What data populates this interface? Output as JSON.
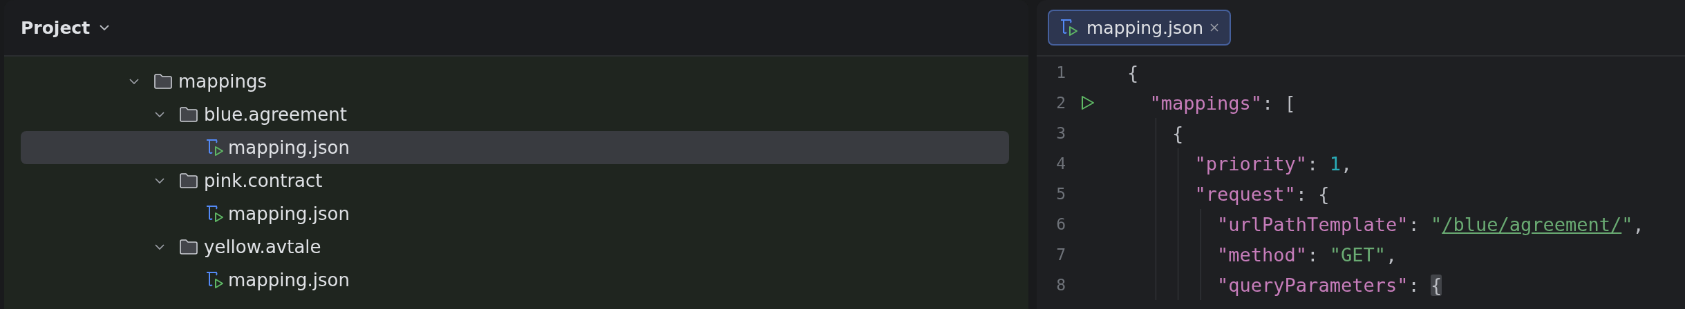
{
  "project_panel": {
    "title": "Project",
    "tree": [
      {
        "label": "mappings",
        "kind": "folder",
        "expanded": true,
        "selected": false,
        "children": [
          {
            "label": "blue.agreement",
            "kind": "folder",
            "expanded": true,
            "selected": false,
            "children": [
              {
                "label": "mapping.json",
                "kind": "file",
                "selected": true
              }
            ]
          },
          {
            "label": "pink.contract",
            "kind": "folder",
            "expanded": true,
            "selected": false,
            "children": [
              {
                "label": "mapping.json",
                "kind": "file",
                "selected": false
              }
            ]
          },
          {
            "label": "yellow.avtale",
            "kind": "folder",
            "expanded": true,
            "selected": false,
            "children": [
              {
                "label": "mapping.json",
                "kind": "file",
                "selected": false
              }
            ]
          }
        ]
      }
    ]
  },
  "editor": {
    "tabs": [
      {
        "label": "mapping.json",
        "selected": true
      }
    ],
    "lines": [
      {
        "number": "1",
        "tokens": [
          {
            "kind": "punct",
            "text": "{"
          }
        ],
        "children": [
          {
            "number": "2",
            "run": true,
            "tokens": [
              {
                "kind": "key",
                "text": "\"mappings\""
              },
              {
                "kind": "punct",
                "text": ": ["
              }
            ],
            "children": [
              {
                "number": "3",
                "tokens": [
                  {
                    "kind": "punct",
                    "text": "{"
                  }
                ],
                "children": [
                  {
                    "number": "4",
                    "tokens": [
                      {
                        "kind": "key",
                        "text": "\"priority\""
                      },
                      {
                        "kind": "punct",
                        "text": ": "
                      },
                      {
                        "kind": "number",
                        "text": "1"
                      },
                      {
                        "kind": "punct",
                        "text": ","
                      }
                    ]
                  },
                  {
                    "number": "5",
                    "tokens": [
                      {
                        "kind": "key",
                        "text": "\"request\""
                      },
                      {
                        "kind": "punct",
                        "text": ": {"
                      }
                    ],
                    "children": [
                      {
                        "number": "6",
                        "tokens": [
                          {
                            "kind": "key",
                            "text": "\"urlPathTemplate\""
                          },
                          {
                            "kind": "punct",
                            "text": ": "
                          },
                          {
                            "kind": "string",
                            "text": "\""
                          },
                          {
                            "kind": "link",
                            "text": "/blue/agreement/"
                          },
                          {
                            "kind": "string",
                            "text": "\""
                          },
                          {
                            "kind": "punct",
                            "text": ","
                          }
                        ]
                      },
                      {
                        "number": "7",
                        "tokens": [
                          {
                            "kind": "key",
                            "text": "\"method\""
                          },
                          {
                            "kind": "punct",
                            "text": ": "
                          },
                          {
                            "kind": "string",
                            "text": "\"GET\""
                          },
                          {
                            "kind": "punct",
                            "text": ","
                          }
                        ]
                      },
                      {
                        "number": "8",
                        "tokens": [
                          {
                            "kind": "key",
                            "text": "\"queryParameters\""
                          },
                          {
                            "kind": "punct",
                            "text": ": "
                          },
                          {
                            "kind": "brace-match",
                            "text": "{"
                          }
                        ]
                      }
                    ]
                  }
                ]
              }
            ]
          }
        ]
      }
    ]
  }
}
